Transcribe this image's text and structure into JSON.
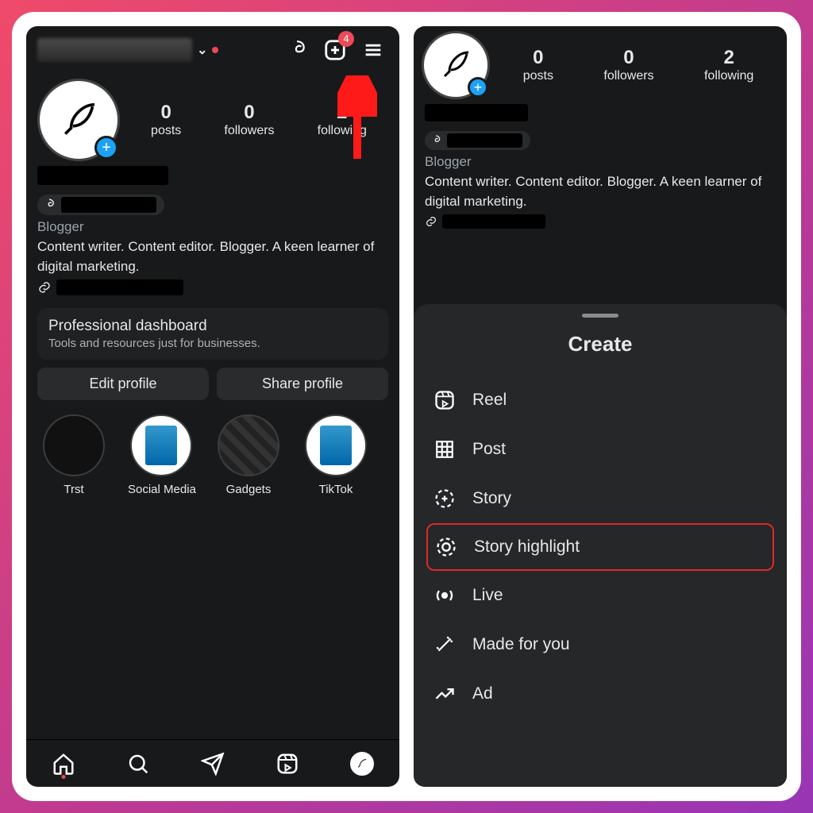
{
  "badge_count": "4",
  "stats": {
    "posts": {
      "num": "0",
      "label": "posts"
    },
    "followers": {
      "num": "0",
      "label": "followers"
    },
    "following": {
      "num": "2",
      "label": "following"
    }
  },
  "profile": {
    "category": "Blogger",
    "bio": "Content writer. Content editor. Blogger. A keen learner of digital marketing."
  },
  "dashboard": {
    "title": "Professional dashboard",
    "subtitle": "Tools and resources just for businesses."
  },
  "buttons": {
    "edit": "Edit profile",
    "share": "Share profile"
  },
  "highlights": [
    {
      "label": "Trst"
    },
    {
      "label": "Social Media"
    },
    {
      "label": "Gadgets"
    },
    {
      "label": "TikTok"
    }
  ],
  "create_sheet": {
    "title": "Create",
    "items": [
      {
        "label": "Reel"
      },
      {
        "label": "Post"
      },
      {
        "label": "Story"
      },
      {
        "label": "Story highlight"
      },
      {
        "label": "Live"
      },
      {
        "label": "Made for you"
      },
      {
        "label": "Ad"
      }
    ]
  }
}
